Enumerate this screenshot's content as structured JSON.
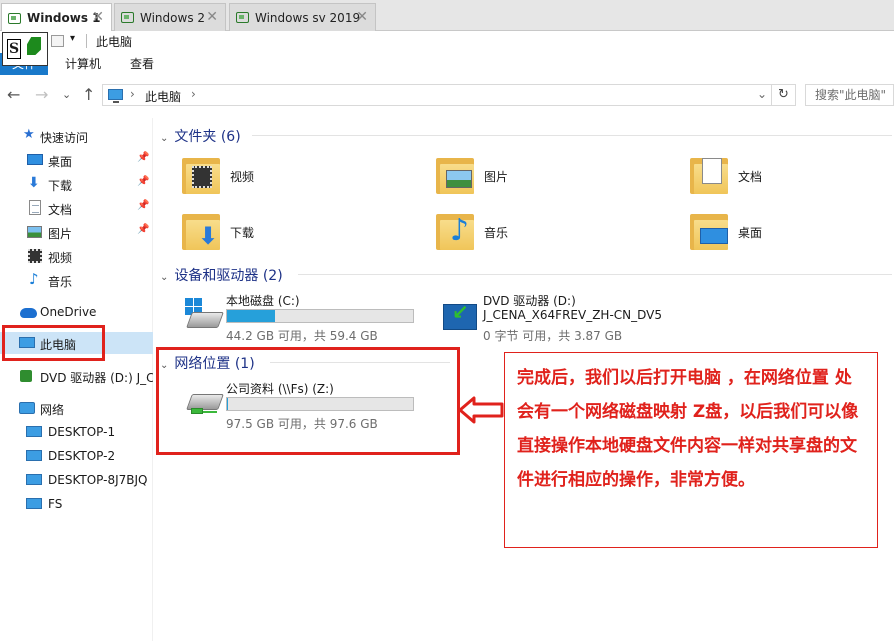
{
  "vm_tabs": [
    {
      "label": "Windows 1",
      "active": true
    },
    {
      "label": "Windows 2",
      "active": false
    },
    {
      "label": "Windows sv 2019",
      "active": false
    }
  ],
  "qat": {
    "title": "此电脑",
    "s_letter": "S"
  },
  "ribbon": {
    "file": "文件",
    "tabs": [
      "计算机",
      "查看"
    ]
  },
  "address": {
    "path": "此电脑",
    "chevron": "›",
    "search_placeholder": "搜索\"此电脑\""
  },
  "nav": {
    "quick_access": "快速访问",
    "quick_items": [
      "桌面",
      "下载",
      "文档",
      "图片",
      "视频",
      "音乐"
    ],
    "onedrive": "OneDrive",
    "this_pc": "此电脑",
    "dvd": "DVD 驱动器 (D:) J_C",
    "network": "网络",
    "network_items": [
      "DESKTOP-1",
      "DESKTOP-2",
      "DESKTOP-8J7BJQ",
      "FS"
    ]
  },
  "folders_section": {
    "title": "文件夹 (6)",
    "items": [
      "视频",
      "图片",
      "文档",
      "下载",
      "音乐",
      "桌面"
    ]
  },
  "devices_section": {
    "title": "设备和驱动器 (2)",
    "local_disk": {
      "name": "本地磁盘 (C:)",
      "free_text": "44.2 GB 可用，共 59.4 GB",
      "used_fraction": 0.256
    },
    "dvd": {
      "name": "DVD 驱动器 (D:)",
      "label": "J_CENA_X64FREV_ZH-CN_DV5",
      "free_text": "0 字节 可用，共 3.87 GB"
    }
  },
  "network_section": {
    "title": "网络位置 (1)",
    "drive": {
      "name": "公司资料 (\\\\Fs) (Z:)",
      "free_text": "97.5 GB 可用，共 97.6 GB",
      "used_fraction": 0.001
    }
  },
  "annotation": {
    "text": "完成后，我们以后打开电脑 ，在网络位置 处 会有一个网络磁盘映射 Z盘，以后我们可以像直接操作本地硬盘文件内容一样对共享盘的文件进行相应的操作，非常方便。"
  },
  "colors": {
    "accent": "#1979ca",
    "annotation_red": "#e0221c",
    "progress_fill": "#26a0da",
    "section_title": "#1e3287"
  }
}
